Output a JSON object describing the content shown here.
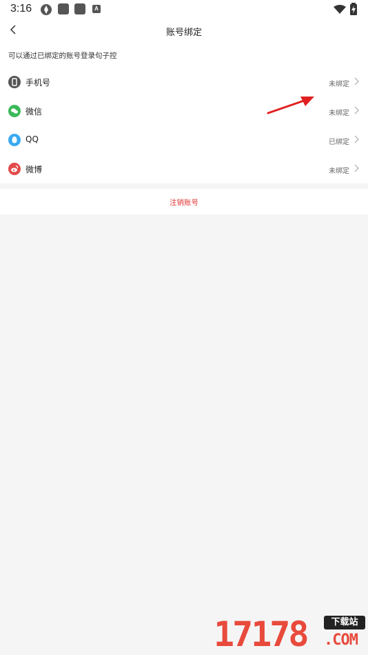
{
  "status_bar": {
    "time": "3:16",
    "notification_letter": "A",
    "icons": [
      "app-icon",
      "square-icon",
      "square-icon",
      "a-badge-icon",
      "wifi-icon",
      "battery-charging-icon"
    ]
  },
  "header": {
    "title": "账号绑定",
    "back_icon": "chevron-left-icon"
  },
  "hint": "可以通过已绑定的账号登录句子控",
  "accounts": [
    {
      "label": "手机号",
      "status": "未绑定",
      "icon": "phone-icon",
      "color": "#555555"
    },
    {
      "label": "微信",
      "status": "未绑定",
      "icon": "wechat-icon",
      "color": "#3cb95a"
    },
    {
      "label": "QQ",
      "status": "已绑定",
      "icon": "qq-icon",
      "color": "#3aaaf0"
    },
    {
      "label": "微博",
      "status": "未绑定",
      "icon": "weibo-icon",
      "color": "#e24b4b"
    }
  ],
  "cancel_account_label": "注销账号",
  "annotation": {
    "color": "#e02020"
  },
  "watermark": {
    "digits": "17178",
    "badge": "下载站",
    "domain": ".COM"
  }
}
